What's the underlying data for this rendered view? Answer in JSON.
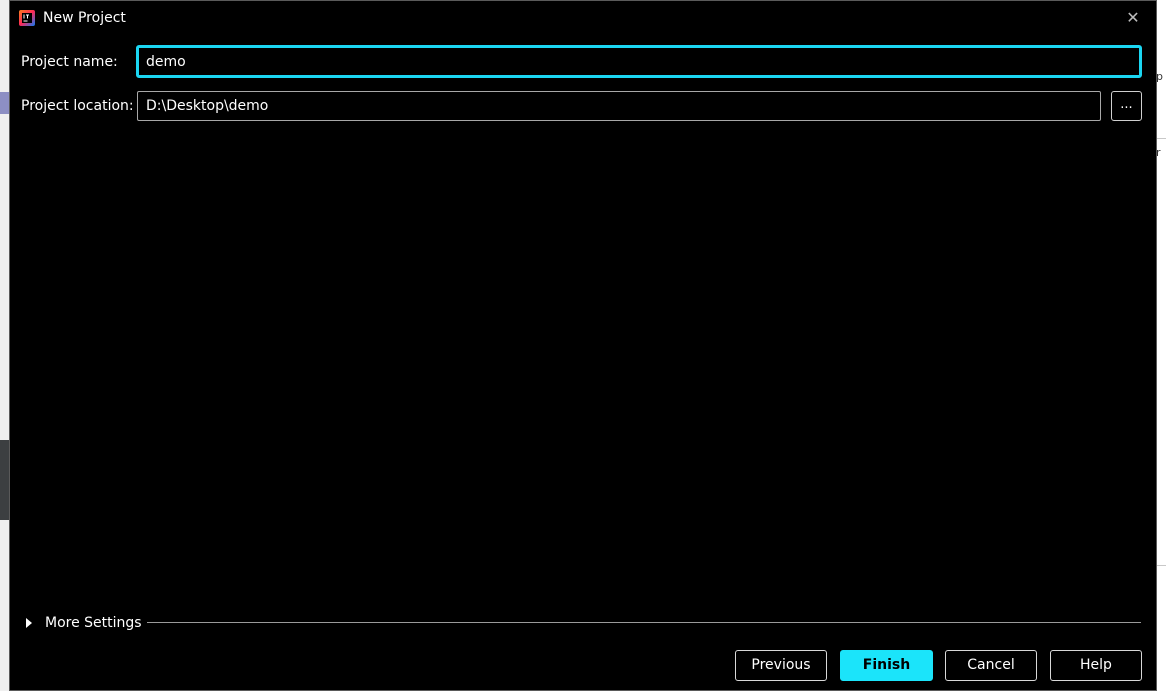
{
  "dialog": {
    "title": "New Project",
    "close_glyph": "✕",
    "icon": "intellij-idea-icon"
  },
  "form": {
    "project_name_label": "Project name:",
    "project_name_value": "demo",
    "project_location_label": "Project location:",
    "project_location_value": "D:\\Desktop\\demo",
    "browse_label": "..."
  },
  "more_settings": {
    "label": "More Settings",
    "expanded": false
  },
  "buttons": {
    "previous": "Previous",
    "finish": "Finish",
    "cancel": "Cancel",
    "help": "Help"
  },
  "background_fragments": {
    "right_glyph_1": "p",
    "right_glyph_2": "r"
  },
  "colors": {
    "accent": "#1bd6f2",
    "finish_button": "#1be4fa",
    "dialog_bg": "#000000",
    "text": "#ffffff"
  }
}
